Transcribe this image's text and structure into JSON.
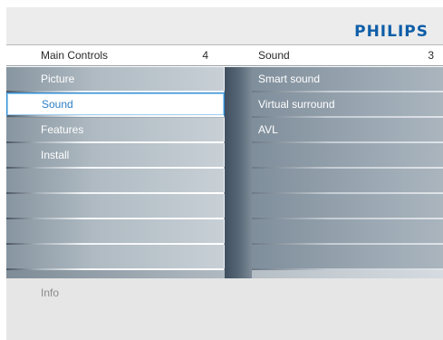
{
  "brand": {
    "logo_text": "PHILIPS",
    "logo_color": "#0f5ea8"
  },
  "main_menu": {
    "title": "Main Controls",
    "count": "4",
    "items": [
      {
        "label": "Picture",
        "selected": false
      },
      {
        "label": "Sound",
        "selected": true
      },
      {
        "label": "Features",
        "selected": false
      },
      {
        "label": "Install",
        "selected": false
      },
      {
        "label": ""
      },
      {
        "label": ""
      },
      {
        "label": ""
      },
      {
        "label": ""
      }
    ]
  },
  "sub_menu": {
    "title": "Sound",
    "count": "3",
    "items": [
      {
        "label": "Smart sound"
      },
      {
        "label": "Virtual surround"
      },
      {
        "label": "AVL"
      },
      {
        "label": ""
      },
      {
        "label": ""
      },
      {
        "label": ""
      },
      {
        "label": ""
      },
      {
        "label": ""
      }
    ]
  },
  "info": {
    "label": "Info"
  },
  "colors": {
    "selection_border": "#2b8ad3",
    "selection_text": "#2c7fc5"
  }
}
